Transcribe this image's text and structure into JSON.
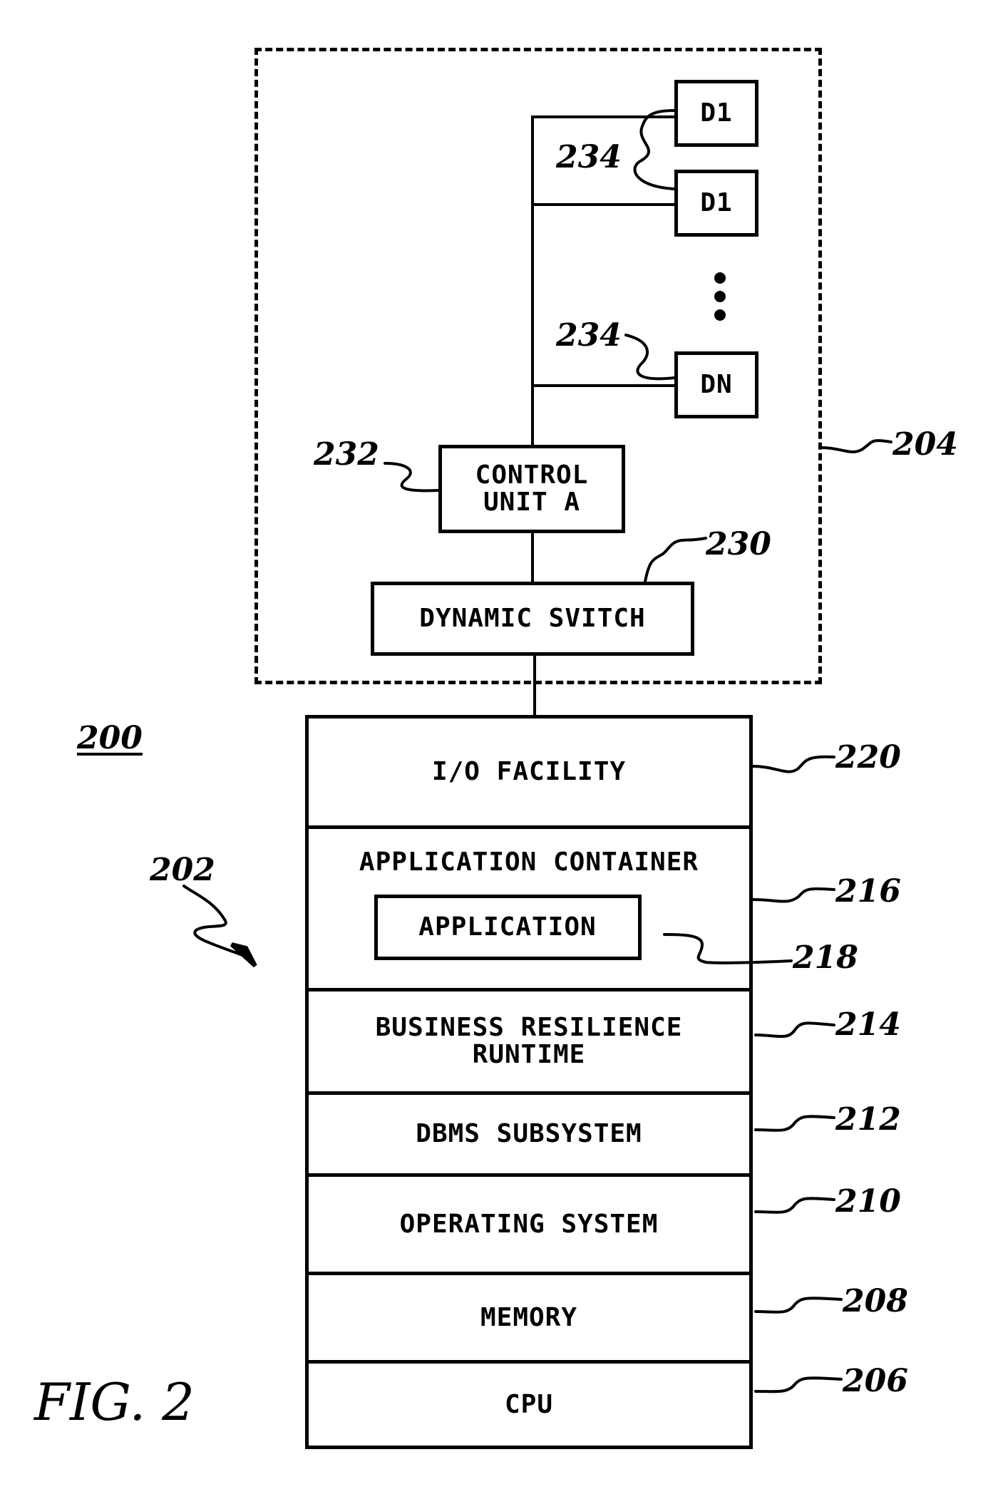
{
  "figure": {
    "label": "FIG. 2",
    "system_ref": "200",
    "server_ref": "202",
    "storage_ref": "204"
  },
  "storage": {
    "devices": [
      {
        "label": "D1",
        "ref": "234"
      },
      {
        "label": "D1",
        "ref": ""
      },
      {
        "label": "DN",
        "ref": "234"
      }
    ],
    "ellipsis": "⋮",
    "control_unit": {
      "label_line1": "CONTROL",
      "label_line2": "UNIT A",
      "ref": "232"
    },
    "dynamic_switch": {
      "label": "DYNAMIC SVITCH",
      "ref": "230"
    }
  },
  "stack": {
    "layers": [
      {
        "label": "I/O FACILITY",
        "ref": "220"
      },
      {
        "label": "APPLICATION CONTAINER",
        "ref": "216",
        "inner": {
          "label": "APPLICATION",
          "ref": "218"
        }
      },
      {
        "label_line1": "BUSINESS RESILIENCE",
        "label_line2": "RUNTIME",
        "ref": "214"
      },
      {
        "label": "DBMS SUBSYSTEM",
        "ref": "212"
      },
      {
        "label": "OPERATING SYSTEM",
        "ref": "210"
      },
      {
        "label": "MEMORY",
        "ref": "208"
      },
      {
        "label": "CPU",
        "ref": "206"
      }
    ]
  }
}
